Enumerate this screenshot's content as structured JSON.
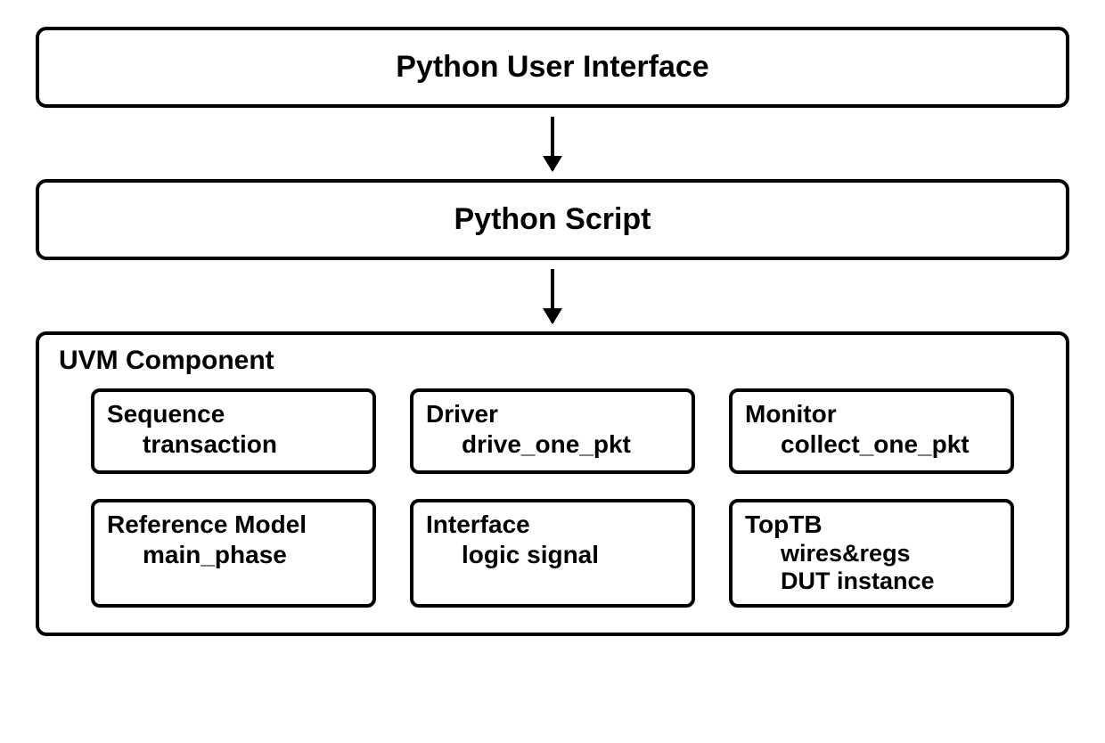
{
  "top_boxes": {
    "box1": "Python User Interface",
    "box2": "Python Script"
  },
  "uvm": {
    "title": "UVM Component",
    "components": {
      "sequence": {
        "title": "Sequence",
        "sub1": "transaction"
      },
      "driver": {
        "title": "Driver",
        "sub1": "drive_one_pkt"
      },
      "monitor": {
        "title": "Monitor",
        "sub1": "collect_one_pkt"
      },
      "refmodel": {
        "title": "Reference Model",
        "sub1": "main_phase"
      },
      "interface": {
        "title": "Interface",
        "sub1": "logic signal"
      },
      "toptb": {
        "title": "TopTB",
        "sub1": "wires&regs",
        "sub2": "DUT instance"
      }
    }
  }
}
